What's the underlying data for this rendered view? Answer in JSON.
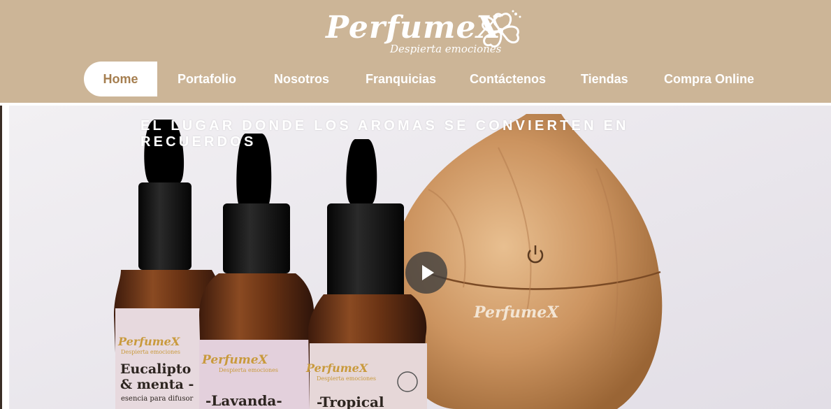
{
  "header": {
    "logo_text": "PerfumeX",
    "logo_tagline": "Despierta emociones",
    "logo_icon": "hibiscus-flower-icon",
    "background_color": "#ccb597"
  },
  "nav": {
    "items": [
      {
        "label": "Home",
        "active": true
      },
      {
        "label": "Portafolio",
        "active": false
      },
      {
        "label": "Nosotros",
        "active": false
      },
      {
        "label": "Franquicias",
        "active": false
      },
      {
        "label": "Contáctenos",
        "active": false
      },
      {
        "label": "Tiendas",
        "active": false
      },
      {
        "label": "Compra Online",
        "active": false
      }
    ],
    "active_color": "#a57e4f"
  },
  "hero": {
    "tagline": "EL LUGAR DONDE LOS AROMAS SE CONVIERTEN EN RECUERDOS",
    "play_icon": "play-icon",
    "diffuser_brand": "PerfumeX",
    "power_icon": "power-icon",
    "bottles": [
      {
        "brand": "PerfumeX",
        "brand_sub": "Despierta emociones",
        "name_line1": "Eucalipto",
        "name_line2": "& menta -",
        "detail": "esencia para difusor"
      },
      {
        "brand": "PerfumeX",
        "brand_sub": "Despierta emociones",
        "name_line1": "-Lavanda-"
      },
      {
        "brand": "PerfumeX",
        "brand_sub": "Despierta emociones",
        "name_line1": "-Tropical"
      }
    ]
  }
}
